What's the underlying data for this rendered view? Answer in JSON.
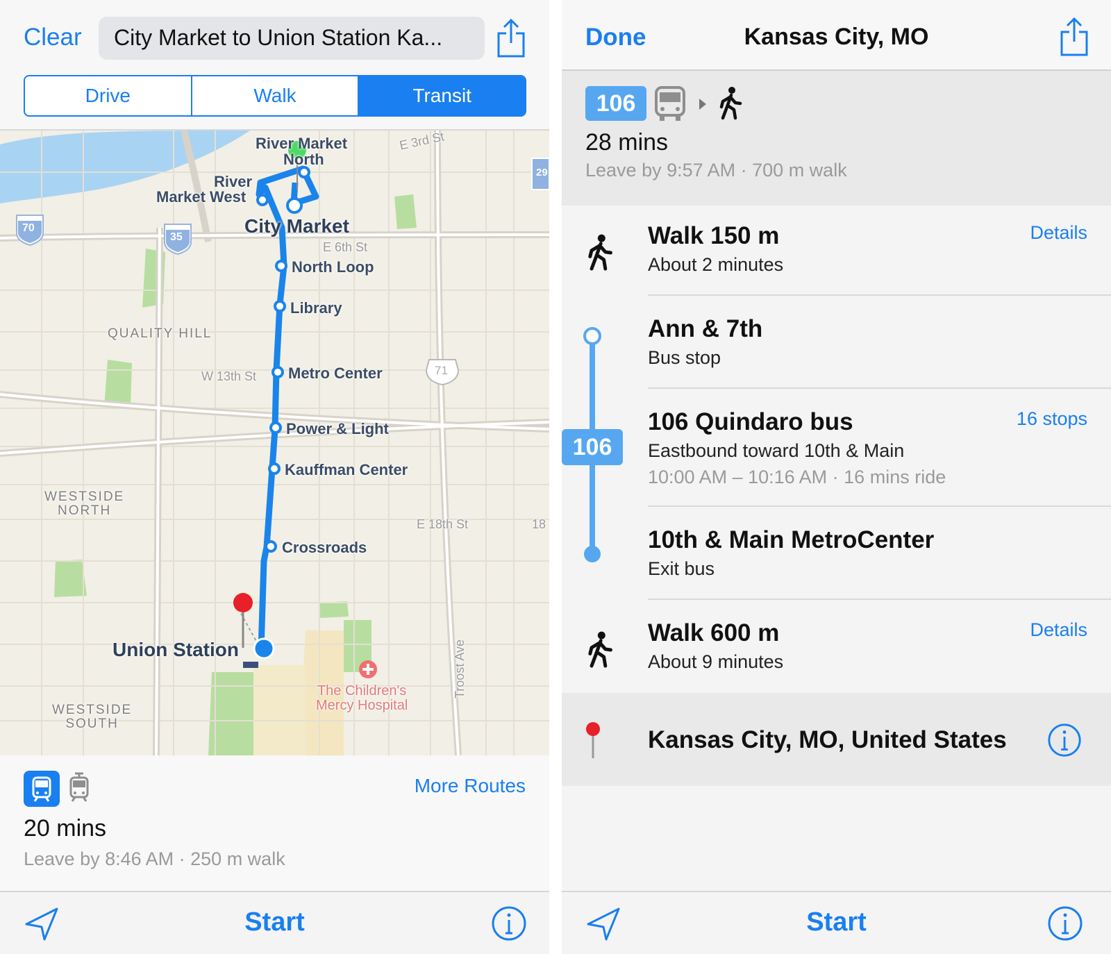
{
  "left": {
    "header": {
      "clear_label": "Clear",
      "route_title": "City Market to Union Station Ka...",
      "share_icon": "share-icon"
    },
    "modes": [
      {
        "label": "Drive",
        "active": false
      },
      {
        "label": "Walk",
        "active": false
      },
      {
        "label": "Transit",
        "active": true
      }
    ],
    "map": {
      "stops": [
        "River Market North",
        "River Market West",
        "City Market",
        "North Loop",
        "Library",
        "Metro Center",
        "Power & Light",
        "Kauffman Center",
        "Crossroads",
        "Union Station"
      ],
      "stop_river_market_north_1": "River Market",
      "stop_river_market_north_2": "North",
      "stop_river_market_west_1": "River",
      "stop_river_market_west_2": "Market West",
      "stop_city_market": "City Market",
      "stop_north_loop": "North Loop",
      "stop_library": "Library",
      "stop_metro_center": "Metro Center",
      "stop_power_light": "Power & Light",
      "stop_kauffman": "Kauffman Center",
      "stop_crossroads": "Crossroads",
      "stop_union_station": "Union Station",
      "area_quality_hill": "QUALITY HILL",
      "area_westside_north_1": "WESTSIDE",
      "area_westside_north_2": "NORTH",
      "area_westside_south_1": "WESTSIDE",
      "area_westside_south_2": "SOUTH",
      "street_e3rd": "E 3rd St",
      "street_e6th": "E 6th St",
      "street_w13th": "W 13th St",
      "street_e18th": "E 18th St",
      "street_18": "18",
      "street_troost": "Troost Ave",
      "hospital_1": "The Children's",
      "hospital_2": "Mercy Hospital",
      "shield_70": "70",
      "shield_35": "35",
      "shield_71": "71",
      "shield_29": "29",
      "colors": {
        "route": "#1a84ea",
        "water": "#a9d3f2",
        "park": "#b7dea0",
        "origin": "#4cd964",
        "destination": "#e8202a"
      }
    },
    "route_card": {
      "more_routes_label": "More Routes",
      "duration": "20 mins",
      "leave_info": "Leave by 8:46 AM · 250 m walk",
      "icons": [
        "tram-icon-selected",
        "tram-icon"
      ]
    },
    "toolbar": {
      "start_label": "Start"
    }
  },
  "right": {
    "header": {
      "done_label": "Done",
      "title": "Kansas City, MO"
    },
    "summary": {
      "bus_number": "106",
      "duration": "28 mins",
      "leave_info": "Leave by 9:57 AM · 700 m walk"
    },
    "steps": {
      "walk1_title": "Walk 150 m",
      "walk1_sub": "About 2 minutes",
      "walk1_link": "Details",
      "stop1_title": "Ann & 7th",
      "stop1_sub": "Bus stop",
      "bus_title": "106 Quindaro bus",
      "bus_sub": "Eastbound toward 10th & Main",
      "bus_time": "10:00 AM – 10:16 AM · 16 mins ride",
      "bus_link": "16 stops",
      "bus_badge": "106",
      "stop2_title": "10th & Main MetroCenter",
      "stop2_sub": "Exit bus",
      "walk2_title": "Walk 600 m",
      "walk2_sub": "About 9 minutes",
      "walk2_link": "Details"
    },
    "destination": {
      "label": "Kansas City, MO, United States"
    },
    "toolbar": {
      "start_label": "Start"
    }
  }
}
